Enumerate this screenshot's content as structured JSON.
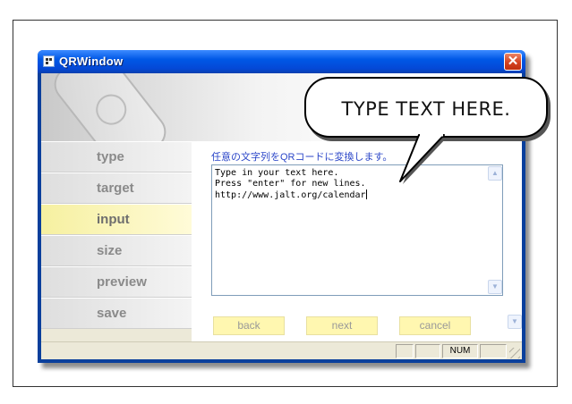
{
  "window": {
    "title": "QRWindow",
    "close_glyph": "✕",
    "icons": {
      "app": "qr-app-icon",
      "close": "close-icon"
    }
  },
  "sidebar": {
    "items": [
      {
        "label": "type",
        "active": false
      },
      {
        "label": "target",
        "active": false
      },
      {
        "label": "input",
        "active": true
      },
      {
        "label": "size",
        "active": false
      },
      {
        "label": "preview",
        "active": false
      },
      {
        "label": "save",
        "active": false
      }
    ]
  },
  "main": {
    "instruction": "任意の文字列をQRコードに変換します。",
    "textarea_lines": [
      "Type in your text here.",
      "Press \"enter\" for new lines.",
      "http://www.jalt.org/calendar"
    ]
  },
  "buttons": {
    "back": "back",
    "next": "next",
    "cancel": "cancel"
  },
  "statusbar": {
    "panes": [
      "",
      "",
      "NUM",
      ""
    ]
  },
  "callout": {
    "text": "TYPE TEXT HERE."
  },
  "colors": {
    "titlebar": "#0058e6",
    "active_item": "#fff7b0",
    "instruction_text": "#2b46c8",
    "button_bg": "#fff7b0"
  }
}
